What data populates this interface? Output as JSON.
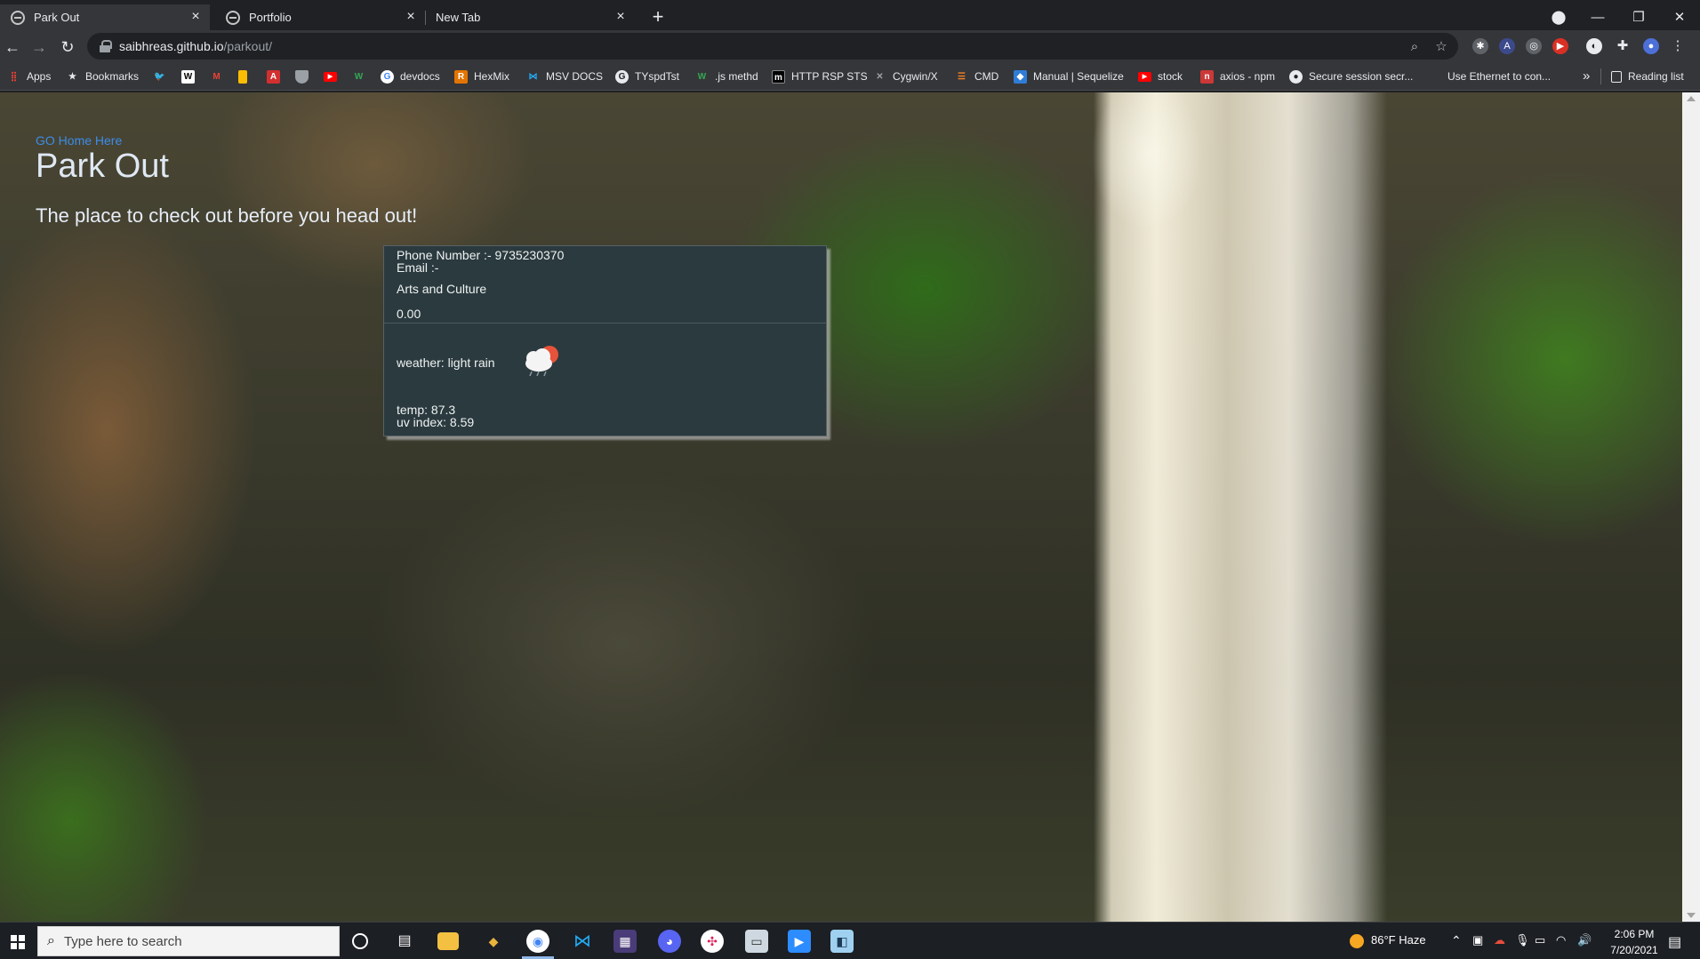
{
  "browser": {
    "tabs": [
      {
        "title": "Park Out",
        "active": true
      },
      {
        "title": "Portfolio",
        "active": false
      },
      {
        "title": "New Tab",
        "active": false
      }
    ],
    "new_tab_icon": "plus-icon",
    "window_controls": [
      "minimize-icon",
      "restore-icon",
      "close-icon"
    ],
    "address": {
      "host": "saibhreas.github.io",
      "path": "/parkout/"
    },
    "bookmarks": [
      {
        "label": "Apps",
        "icon": "apps-grid-icon",
        "color": "#ea4335"
      },
      {
        "label": "Bookmarks",
        "icon": "star-icon",
        "color": "#e8eaed"
      },
      {
        "label": "",
        "icon": "twitter-icon",
        "color": "#1da1f2"
      },
      {
        "label": "",
        "icon": "wikipedia-icon",
        "color": "#ffffff"
      },
      {
        "label": "",
        "icon": "gmail-icon",
        "color": "#ea4335"
      },
      {
        "label": "",
        "icon": "keep-icon",
        "color": "#fbbc04"
      },
      {
        "label": "",
        "icon": "pdf-icon",
        "color": "#d32f2f"
      },
      {
        "label": "",
        "icon": "shield-icon",
        "color": "#9aa0a6"
      },
      {
        "label": "",
        "icon": "youtube-icon",
        "color": "#ff0000"
      },
      {
        "label": "",
        "icon": "w-icon",
        "color": "#34a853"
      },
      {
        "label": "devdocs",
        "icon": "google-icon",
        "color": "#4285f4"
      },
      {
        "label": "HexMix",
        "icon": "r-icon",
        "color": "#e37400"
      },
      {
        "label": "MSV DOCS",
        "icon": "vscode-icon",
        "color": "#23a9f2"
      },
      {
        "label": "TYspdTst",
        "icon": "google-icon",
        "color": "#e8eaed"
      },
      {
        "label": ".js methd",
        "icon": "w-icon",
        "color": "#34a853"
      },
      {
        "label": "HTTP RSP STS",
        "icon": "mdn-icon",
        "color": "#000000"
      },
      {
        "label": "Cygwin/X",
        "icon": "x-icon",
        "color": "#9aa0a6"
      },
      {
        "label": "CMD",
        "icon": "stack-icon",
        "color": "#f48024"
      },
      {
        "label": "Manual | Sequelize",
        "icon": "sequelize-icon",
        "color": "#2f7cd8"
      },
      {
        "label": "stock",
        "icon": "youtube-icon",
        "color": "#ff0000"
      },
      {
        "label": "axios - npm",
        "icon": "npm-icon",
        "color": "#cb3837"
      },
      {
        "label": "Secure session secr...",
        "icon": "github-icon",
        "color": "#e8eaed"
      },
      {
        "label": "Use Ethernet to con...",
        "icon": "apple-icon",
        "color": "#e8eaed"
      }
    ],
    "more_bookmarks": "»",
    "reading_list": "Reading list"
  },
  "page": {
    "go_home": "GO Home Here",
    "title": "Park Out",
    "subtitle": "The place to check out before you head out!",
    "card": {
      "phone": "Phone Number :- 9735230370",
      "email": "Email :-",
      "category": "Arts and Culture",
      "fee": "0.00",
      "weather": "weather: light rain",
      "weather_icon": "rain-cloud-icon",
      "temp": "temp: 87.3",
      "uv": "uv index: 8.59"
    }
  },
  "taskbar": {
    "search_placeholder": "Type here to search",
    "weather": "86°F  Haze",
    "time": "2:06 PM",
    "date": "7/20/2021",
    "apps": [
      "cortana-icon",
      "task-view-icon",
      "file-explorer-icon",
      "app-icon",
      "chrome-icon",
      "vscode-icon",
      "app-icon",
      "discord-icon",
      "slack-icon",
      "app-icon",
      "zoom-icon",
      "app-icon"
    ]
  }
}
